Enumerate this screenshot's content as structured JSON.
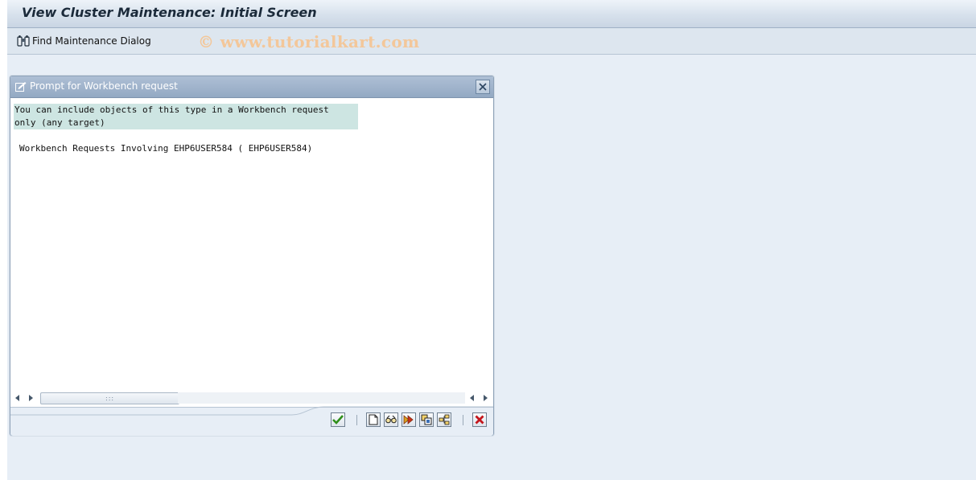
{
  "window": {
    "title": "View Cluster Maintenance: Initial Screen"
  },
  "application_toolbar": {
    "find_button_label": "Find Maintenance Dialog"
  },
  "watermark": "© www.tutorialkart.com",
  "dialog": {
    "title": "Prompt for Workbench request",
    "message_lines": [
      "You can include objects of this type in a Workbench request",
      "only (any target)"
    ],
    "requests_label": "Workbench Requests Involving EHP6USER584 ( EHP6USER584)",
    "footer_buttons": [
      {
        "name": "continue-button",
        "icon": "checkmark-icon"
      },
      {
        "name": "create-request-button",
        "icon": "new-document-icon"
      },
      {
        "name": "own-requests-button",
        "icon": "glasses-icon"
      },
      {
        "name": "goto-request-button",
        "icon": "forward-icon"
      },
      {
        "name": "select-button",
        "icon": "copy-icon"
      },
      {
        "name": "hierarchy-button",
        "icon": "hierarchy-icon"
      },
      {
        "name": "cancel-button",
        "icon": "cancel-icon"
      }
    ]
  },
  "colors": {
    "screen_bg": "#e7eef6",
    "dialog_title_bg": "#93a9c3",
    "message_highlight": "#cde5e2",
    "watermark": "#f3c79a",
    "accept_green": "#2f8f1b",
    "cancel_red": "#c4161c"
  }
}
